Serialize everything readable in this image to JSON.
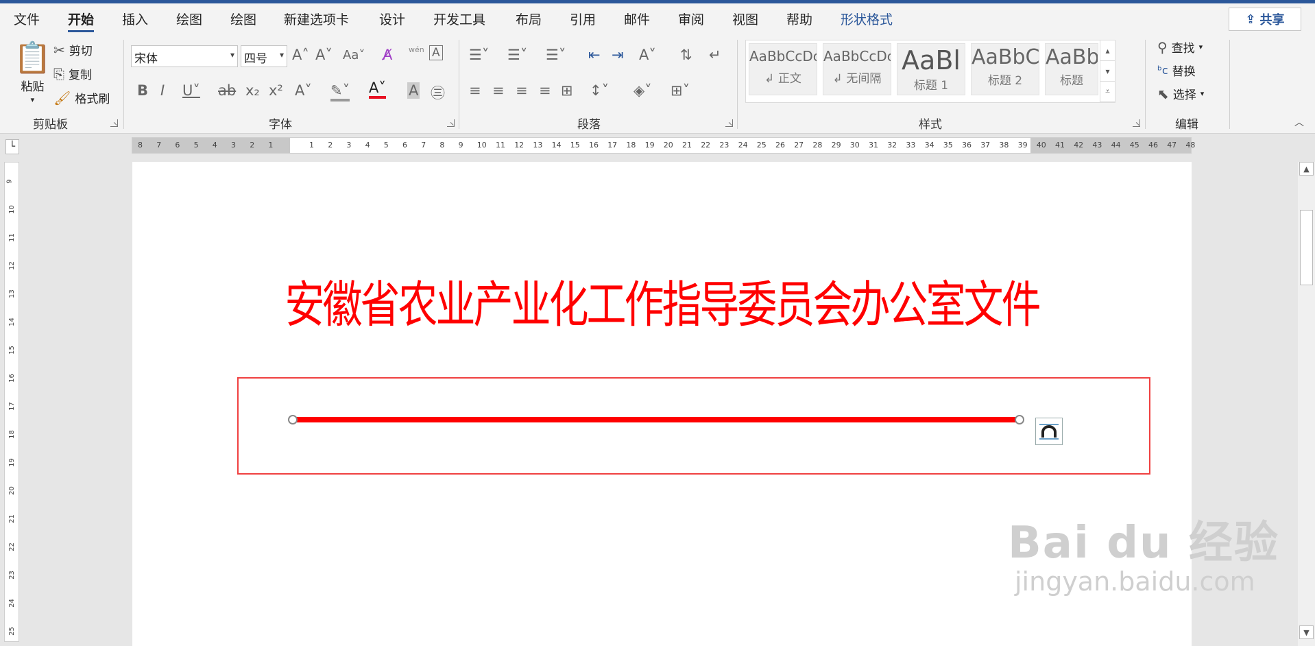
{
  "tabs": [
    {
      "label": "文件"
    },
    {
      "label": "开始"
    },
    {
      "label": "插入"
    },
    {
      "label": "绘图"
    },
    {
      "label": "绘图"
    },
    {
      "label": "新建选项卡"
    },
    {
      "label": "设计"
    },
    {
      "label": "开发工具"
    },
    {
      "label": "布局"
    },
    {
      "label": "引用"
    },
    {
      "label": "邮件"
    },
    {
      "label": "审阅"
    },
    {
      "label": "视图"
    },
    {
      "label": "帮助"
    },
    {
      "label": "形状格式"
    }
  ],
  "share_label": "共享",
  "clipboard": {
    "paste": "粘贴",
    "cut": "剪切",
    "copy": "复制",
    "format_painter": "格式刷",
    "group": "剪贴板"
  },
  "font": {
    "name": "宋体",
    "size": "四号",
    "group": "字体",
    "case": "Aa",
    "phonetic": "wén"
  },
  "paragraph": {
    "group": "段落"
  },
  "styles": {
    "group": "样式",
    "items": [
      {
        "sample": "AaBbCcDc",
        "name": "↲ 正文"
      },
      {
        "sample": "AaBbCcDc",
        "name": "↲ 无间隔"
      },
      {
        "sample": "AaBl",
        "name": "标题 1"
      },
      {
        "sample": "AaBbC",
        "name": "标题 2"
      },
      {
        "sample": "AaBbC",
        "name": "标题"
      }
    ]
  },
  "editing": {
    "find": "查找",
    "replace": "替换",
    "select": "选择",
    "group": "编辑"
  },
  "ruler": {
    "left_numbers": [
      "8",
      "7",
      "6",
      "5",
      "4",
      "3",
      "2",
      "1"
    ],
    "right_numbers": [
      "1",
      "2",
      "3",
      "4",
      "5",
      "6",
      "7",
      "8",
      "9",
      "10",
      "11",
      "12",
      "13",
      "14",
      "15",
      "16",
      "17",
      "18",
      "19",
      "20",
      "21",
      "22",
      "23",
      "24",
      "25",
      "26",
      "27",
      "28",
      "29",
      "30",
      "31",
      "32",
      "33",
      "34",
      "35",
      "36",
      "37",
      "38",
      "39",
      "40",
      "41",
      "42",
      "43",
      "44",
      "45",
      "46",
      "47",
      "48"
    ],
    "vertical_numbers": [
      "9",
      "10",
      "11",
      "12",
      "13",
      "14",
      "15",
      "16",
      "17",
      "18",
      "19",
      "20",
      "21",
      "22",
      "23",
      "24",
      "25"
    ]
  },
  "document": {
    "title": "安徽省农业产业化工作指导委员会办公室文件"
  },
  "watermark": {
    "main": "Bai du 经验",
    "sub": "jingyan.baidu.com"
  }
}
